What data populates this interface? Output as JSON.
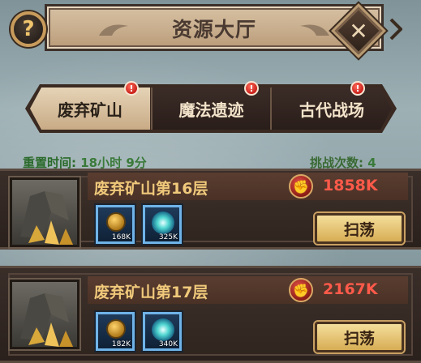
{
  "header": {
    "title": "资源大厅",
    "help_label": "?",
    "close_label": "✕"
  },
  "tabs": [
    {
      "label": "废弃矿山",
      "active": true,
      "alert": "!"
    },
    {
      "label": "魔法遗迹",
      "active": false,
      "alert": "!"
    },
    {
      "label": "古代战场",
      "active": false,
      "alert": "!"
    }
  ],
  "info": {
    "reset_label": "重置时间:",
    "reset_value": "18小时 9分",
    "challenge_label": "挑战次数:",
    "challenge_value": "4"
  },
  "stages": [
    {
      "name": "废弃矿山第16层",
      "power": "1858K",
      "rewards": [
        {
          "icon": "gold-coin-icon",
          "amount": "168K"
        },
        {
          "icon": "mana-crystal-icon",
          "amount": "325K"
        }
      ],
      "sweep_label": "扫荡"
    },
    {
      "name": "废弃矿山第17层",
      "power": "2167K",
      "rewards": [
        {
          "icon": "gold-coin-icon",
          "amount": "182K"
        },
        {
          "icon": "mana-crystal-icon",
          "amount": "340K"
        }
      ],
      "sweep_label": "扫荡"
    }
  ],
  "colors": {
    "accent_gold": "#f0c97b",
    "power_red": "#ff5a4a",
    "info_green": "#2a6a2a"
  }
}
